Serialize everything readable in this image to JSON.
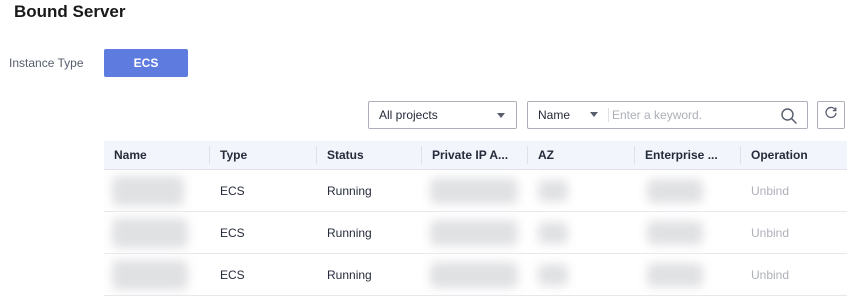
{
  "title": "Bound Server",
  "instance_type": {
    "label": "Instance Type",
    "selected": "ECS"
  },
  "filters": {
    "project_select": "All projects",
    "search_field": "Name",
    "search_placeholder": "Enter a keyword."
  },
  "icons": {
    "search": "search-icon",
    "refresh": "refresh-icon",
    "dropdown": "chevron-down-icon"
  },
  "table": {
    "columns": [
      "Name",
      "Type",
      "Status",
      "Private IP A...",
      "AZ",
      "Enterprise ...",
      "Operation"
    ],
    "rows": [
      {
        "type": "ECS",
        "status": "Running",
        "operation": "Unbind"
      },
      {
        "type": "ECS",
        "status": "Running",
        "operation": "Unbind"
      },
      {
        "type": "ECS",
        "status": "Running",
        "operation": "Unbind"
      }
    ]
  },
  "colors": {
    "primary": "#5e7ce0",
    "header_bg": "#f2f5fc",
    "disabled_link": "#adb0b8"
  }
}
